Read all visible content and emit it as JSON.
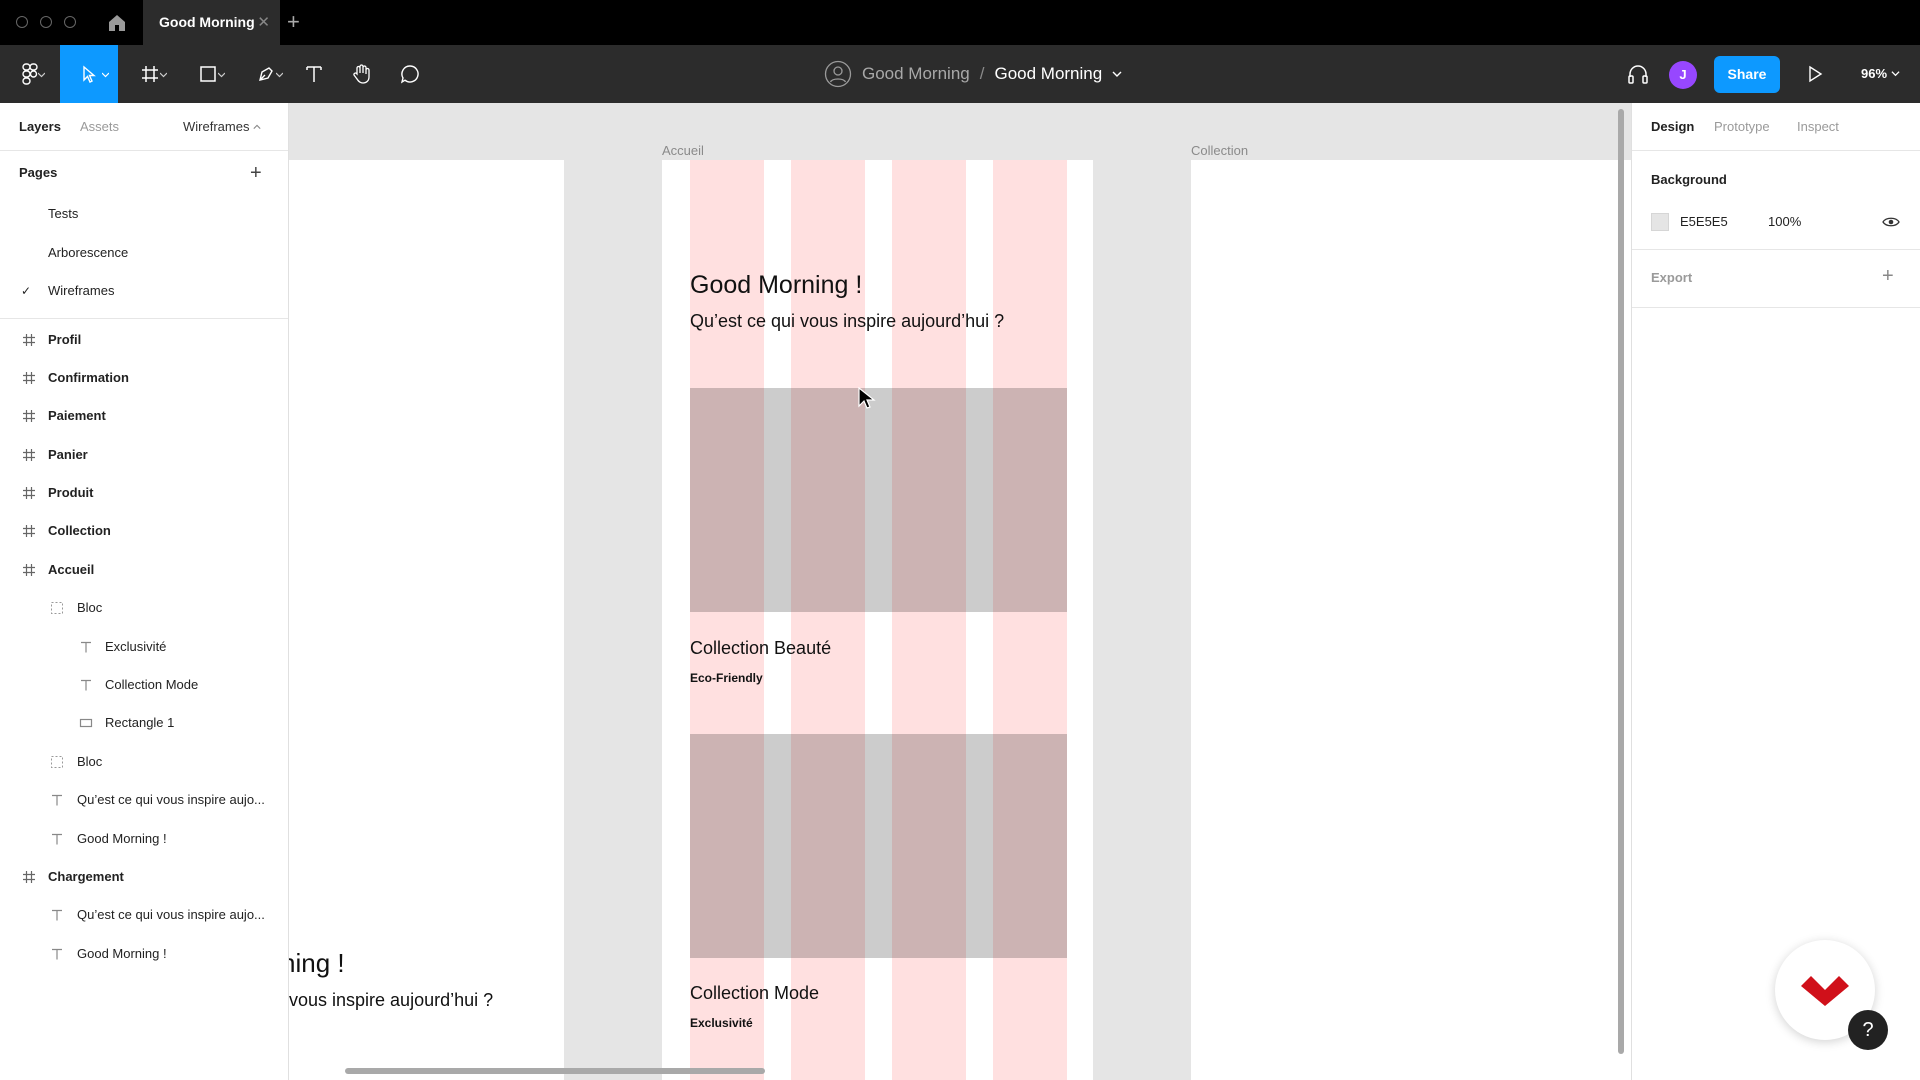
{
  "titlebar": {
    "tab_title": "Good Morning",
    "close_glyph": "✕",
    "new_tab_glyph": "+"
  },
  "toolbar": {
    "breadcrumb_project": "Good Morning",
    "breadcrumb_sep": "/",
    "breadcrumb_file": "Good Morning",
    "avatar_initial": "J",
    "share_label": "Share",
    "zoom_label": "96%",
    "accent_color": "#0d99ff"
  },
  "left_panel": {
    "tabs": [
      "Layers",
      "Assets"
    ],
    "page_selector": "Wireframes",
    "pages_title": "Pages",
    "add_glyph": "+",
    "check_glyph": "✓",
    "pages": [
      "Tests",
      "Arborescence",
      "Wireframes"
    ],
    "current_page": "Wireframes",
    "layers": [
      {
        "label": "Profil",
        "kind": "frame",
        "depth": 0
      },
      {
        "label": "Confirmation",
        "kind": "frame",
        "depth": 0
      },
      {
        "label": "Paiement",
        "kind": "frame",
        "depth": 0
      },
      {
        "label": "Panier",
        "kind": "frame",
        "depth": 0
      },
      {
        "label": "Produit",
        "kind": "frame",
        "depth": 0
      },
      {
        "label": "Collection",
        "kind": "frame",
        "depth": 0
      },
      {
        "label": "Accueil",
        "kind": "frame",
        "depth": 0
      },
      {
        "label": "Bloc",
        "kind": "group",
        "depth": 1
      },
      {
        "label": "Exclusivité",
        "kind": "text",
        "depth": 2
      },
      {
        "label": "Collection Mode",
        "kind": "text",
        "depth": 2
      },
      {
        "label": "Rectangle 1",
        "kind": "rect",
        "depth": 2
      },
      {
        "label": "Bloc",
        "kind": "group",
        "depth": 1
      },
      {
        "label": "Qu’est ce qui vous inspire aujo...",
        "kind": "text",
        "depth": 1
      },
      {
        "label": "Good Morning !",
        "kind": "text",
        "depth": 1
      },
      {
        "label": "Chargement",
        "kind": "frame",
        "depth": 0
      },
      {
        "label": "Qu’est ce qui vous inspire aujo...",
        "kind": "text",
        "depth": 1
      },
      {
        "label": "Good Morning !",
        "kind": "text",
        "depth": 1
      }
    ]
  },
  "canvas": {
    "frame_accueil_label": "Accueil",
    "frame_collection_label": "Collection",
    "heading": "Good Morning !",
    "subheading": "Qu’est ce qui vous inspire aujourd’hui ?",
    "card1_title": "Collection Beauté",
    "card1_tag": "Eco-Friendly",
    "card2_title": "Collection Mode",
    "card2_tag": "Exclusivité",
    "left_frame_heading": "ning !",
    "left_frame_sub": "vous inspire aujourd’hui ?",
    "grid_color": "#ffe0e0",
    "background": "#e5e5e5"
  },
  "right_panel": {
    "tabs": [
      "Design",
      "Prototype",
      "Inspect"
    ],
    "background_title": "Background",
    "bg_hex": "E5E5E5",
    "bg_opacity": "100%",
    "export_title": "Export",
    "add_glyph": "+"
  },
  "help": {
    "glyph": "?"
  }
}
